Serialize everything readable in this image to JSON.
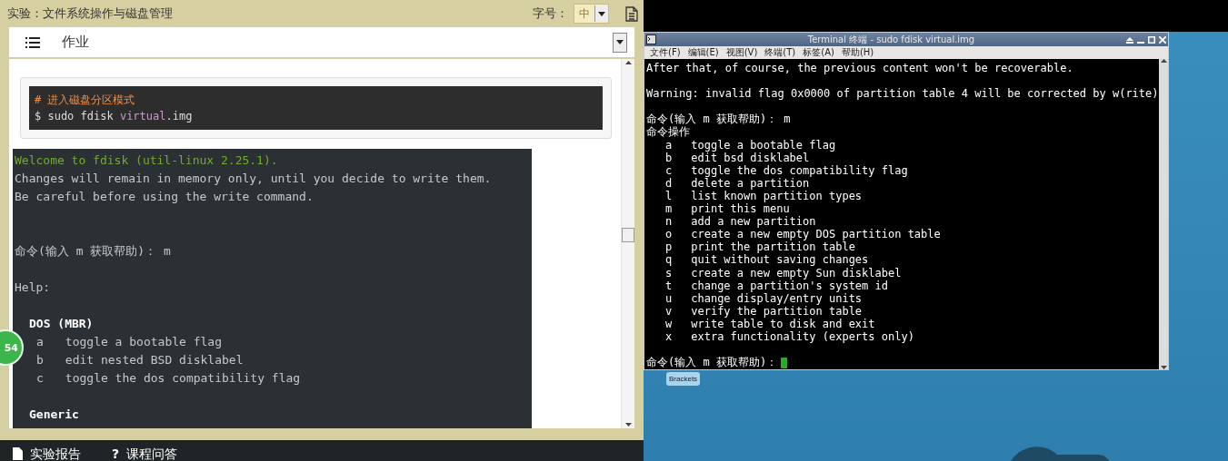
{
  "lesson_bar": {
    "title": "实验：文件系统操作与磁盘管理",
    "font_size_label": "字号：",
    "font_size_value": "中"
  },
  "card": {
    "tab": "作业",
    "code_block": {
      "comment": "# 进入磁盘分区模式",
      "command_prefix": "$ sudo fdisk ",
      "command_highlight": "virtual",
      "command_suffix": ".img"
    },
    "output": [
      {
        "kind": "welcome",
        "text": "Welcome to fdisk (util-linux 2.25.1)."
      },
      {
        "kind": "plain",
        "text": "Changes will remain in memory only, until you decide to write them."
      },
      {
        "kind": "plain",
        "text": "Be careful before using the write command."
      },
      {
        "kind": "blank"
      },
      {
        "kind": "blank"
      },
      {
        "kind": "plain",
        "text": "命令(输入 m 获取帮助)： m"
      },
      {
        "kind": "blank"
      },
      {
        "kind": "plain",
        "text": "Help:"
      },
      {
        "kind": "blank"
      },
      {
        "kind": "heading",
        "text": "DOS (MBR)"
      },
      {
        "kind": "option",
        "key": "a",
        "text": "toggle a bootable flag"
      },
      {
        "kind": "option",
        "key": "b",
        "text": "edit nested BSD disklabel"
      },
      {
        "kind": "option",
        "key": "c",
        "text": "toggle the dos compatibility flag"
      },
      {
        "kind": "blank"
      },
      {
        "kind": "heading",
        "text": "Generic"
      }
    ]
  },
  "badge": "54",
  "bottom_bar": [
    {
      "kind": "document",
      "label": "实验报告"
    },
    {
      "kind": "help",
      "icon": "?",
      "label": "课程问答"
    }
  ],
  "terminal": {
    "title": "Terminal 终端 - sudo fdisk virtual.img",
    "menu": [
      "文件(F)",
      "编辑(E)",
      "视图(V)",
      "终端(T)",
      "标签(A)",
      "帮助(H)"
    ],
    "lines": [
      {
        "kind": "plain",
        "text": "After that, of course, the previous content won't be recoverable."
      },
      {
        "kind": "blank"
      },
      {
        "kind": "plain",
        "text": "Warning: invalid flag 0x0000 of partition table 4 will be corrected by w(rite)"
      },
      {
        "kind": "blank"
      },
      {
        "kind": "plain",
        "text": "命令(输入 m 获取帮助)： m"
      },
      {
        "kind": "plain",
        "text": "命令操作"
      },
      {
        "kind": "option",
        "key": "a",
        "text": "toggle a bootable flag"
      },
      {
        "kind": "option",
        "key": "b",
        "text": "edit bsd disklabel"
      },
      {
        "kind": "option",
        "key": "c",
        "text": "toggle the dos compatibility flag"
      },
      {
        "kind": "option",
        "key": "d",
        "text": "delete a partition"
      },
      {
        "kind": "option",
        "key": "l",
        "text": "list known partition types"
      },
      {
        "kind": "option",
        "key": "m",
        "text": "print this menu"
      },
      {
        "kind": "option",
        "key": "n",
        "text": "add a new partition"
      },
      {
        "kind": "option",
        "key": "o",
        "text": "create a new empty DOS partition table"
      },
      {
        "kind": "option",
        "key": "p",
        "text": "print the partition table"
      },
      {
        "kind": "option",
        "key": "q",
        "text": "quit without saving changes"
      },
      {
        "kind": "option",
        "key": "s",
        "text": "create a new empty Sun disklabel"
      },
      {
        "kind": "option",
        "key": "t",
        "text": "change a partition's system id"
      },
      {
        "kind": "option",
        "key": "u",
        "text": "change display/entry units"
      },
      {
        "kind": "option",
        "key": "v",
        "text": "verify the partition table"
      },
      {
        "kind": "option",
        "key": "w",
        "text": "write table to disk and exit"
      },
      {
        "kind": "option",
        "key": "x",
        "text": "extra functionality (experts only)"
      },
      {
        "kind": "blank"
      },
      {
        "kind": "prompt",
        "text": "命令(输入 m 获取帮助)："
      }
    ]
  },
  "desktop": {
    "app_label": "Brackets"
  }
}
